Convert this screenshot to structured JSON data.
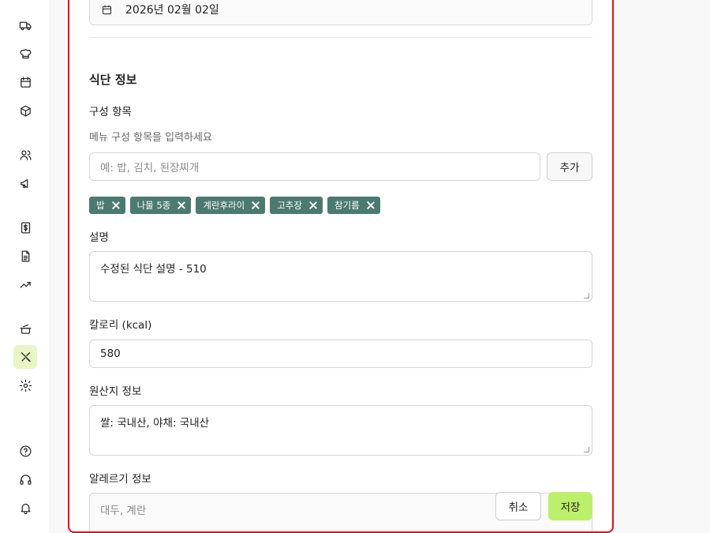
{
  "sidebar": {
    "icons": [
      "truck-icon",
      "chef-hat-icon",
      "calendar-icon",
      "package-icon",
      "users-icon",
      "megaphone-icon",
      "dollar-icon",
      "document-icon",
      "trending-up-icon",
      "cooking-pot-icon",
      "utensils-icon",
      "gear-icon",
      "help-icon",
      "headset-icon",
      "bell-icon"
    ],
    "active": "utensils-icon"
  },
  "form": {
    "date_value": "2026년 02월 02일",
    "section_title": "식단 정보",
    "components_label": "구성 항목",
    "components_hint": "메뉴 구성 항목을 입력하세요",
    "components_placeholder": "예: 밥, 김치, 된장찌개",
    "add_button": "추가",
    "tags": [
      "밥",
      "나물 5종",
      "계란후라이",
      "고추장",
      "참기름"
    ],
    "description_label": "설명",
    "description_value": "수정된 식단 설명 - 510",
    "calorie_label": "칼로리 (kcal)",
    "calorie_value": "580",
    "origin_label": "원산지 정보",
    "origin_value": "쌀: 국내산, 야채: 국내산",
    "allergy_label": "알레르기 정보",
    "allergy_placeholder": "대두, 계란",
    "cancel_button": "취소",
    "save_button": "저장"
  },
  "colors": {
    "accent": "#bdf06a",
    "tag_bg": "#4b7a70",
    "highlight_border": "#e0101e",
    "active_nav_bg": "#e7f6c4"
  }
}
